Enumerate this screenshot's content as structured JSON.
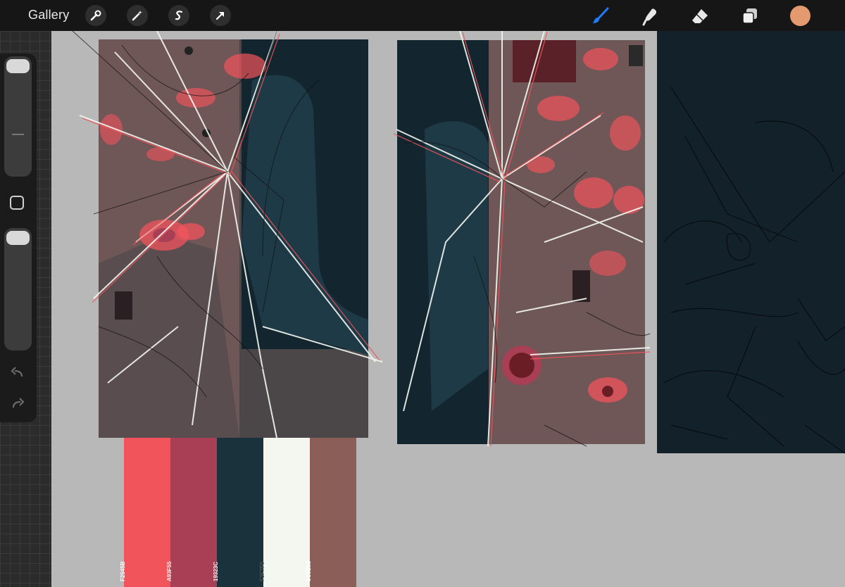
{
  "topbar": {
    "gallery_label": "Gallery",
    "left_tools": [
      "wrench-icon",
      "magic-wand-icon",
      "selection-icon",
      "transform-arrow-icon"
    ],
    "right_tools": [
      "brush-icon",
      "smudge-icon",
      "eraser-icon",
      "layers-icon"
    ],
    "active_tool": "brush-icon",
    "accent_color": "#1f7cff",
    "current_color": "#e49a6f"
  },
  "sidebar": {
    "brush_size_icon": "brush-size-slider",
    "opacity_icon": "opacity-slider",
    "modifier_icon": "square-modifier-icon",
    "undo_icon": "undo-icon",
    "redo_icon": "redo-icon"
  },
  "palette": {
    "swatches": [
      {
        "color": "#F2545B",
        "label": "F2545B"
      },
      {
        "color": "#A93F55",
        "label": "A93F55"
      },
      {
        "color": "#19323C",
        "label": "19323C"
      },
      {
        "color": "#F3F7F0",
        "label": "F3F7F0"
      },
      {
        "color": "#8C5E58",
        "label": "8C5E58"
      }
    ]
  },
  "artwork": {
    "panels": [
      "cracked-glass-panel-1",
      "cracked-glass-panel-2",
      "dark-sketch-panel-3"
    ],
    "colors": {
      "dark_teal": "#19323C",
      "mauve": "#6f5657",
      "grey": "#4b4749",
      "dark": "#13212a"
    }
  }
}
